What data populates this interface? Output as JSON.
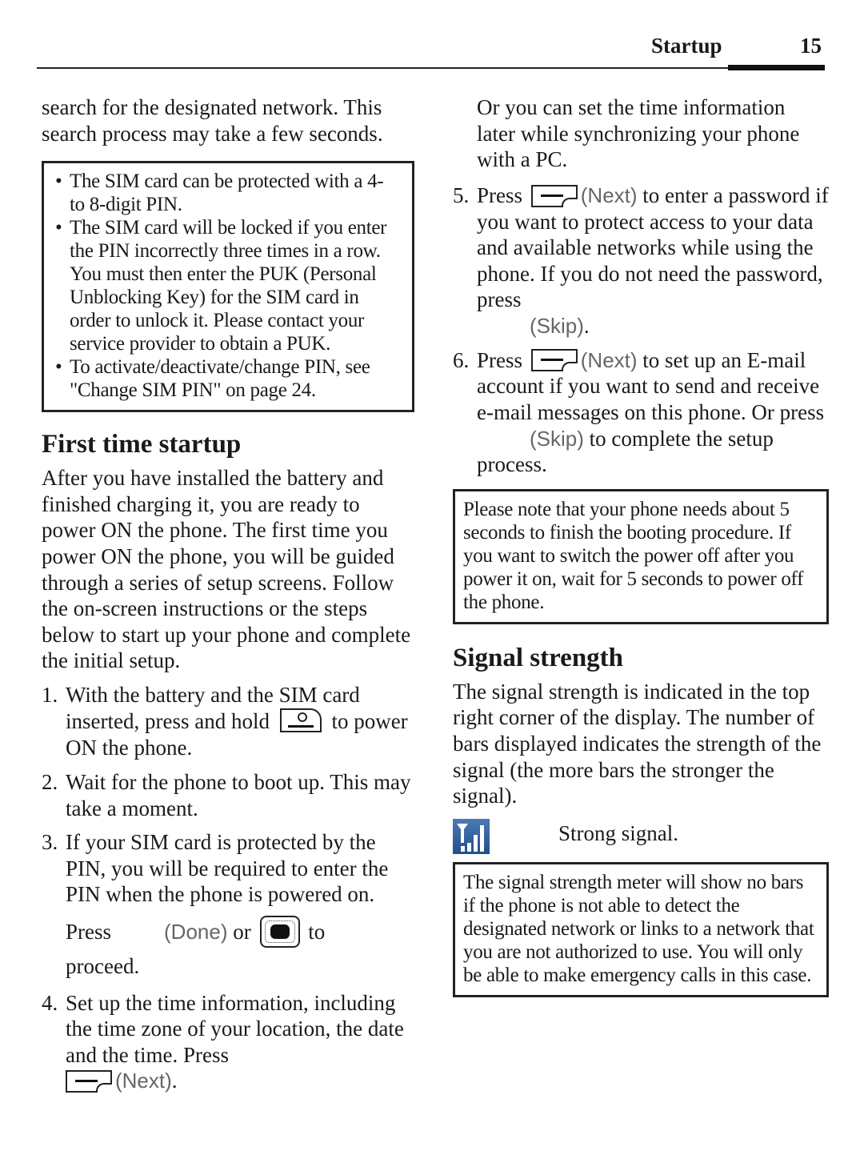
{
  "header": {
    "section": "Startup",
    "page_number": "15"
  },
  "left": {
    "intro_cont": "search for the designated network. This search process may take a few seconds.",
    "pin_box": {
      "bullets": [
        "The SIM card can be protected with a 4- to 8-digit PIN.",
        "The SIM card will be locked if you enter the PIN incorrectly three times in a row. You must then enter the PUK (Personal Unblocking Key) for the SIM card in order to unlock it. Please contact your service provider to obtain a PUK.",
        "To activate/deactivate/change PIN, see \"Change SIM PIN\" on page 24."
      ]
    },
    "heading": "First time startup",
    "intro": "After you have installed the battery and finished charging it, you are ready to power ON the phone. The first time you power ON the phone, you will be guided through a series of setup screens. Follow the on-screen instructions or the steps below to start up your phone and complete the initial setup.",
    "steps": [
      {
        "num": "1.",
        "a": "With the battery and the SIM card inserted, press and hold",
        "b": "to power ON the phone."
      },
      {
        "num": "2.",
        "text": "Wait for the phone to boot up. This may take a moment."
      },
      {
        "num": "3.",
        "text": "If your SIM card is protected by the PIN, you will be required to enter the PIN when the phone is powered on.",
        "press": "Press",
        "softkey": "(Done)",
        "or": "or",
        "to": "to",
        "proceed": "proceed."
      },
      {
        "num": "4.",
        "text": "Set up the time information, including the time zone of your location, the date and the time. Press",
        "softkey": "(Next)",
        "end": "."
      }
    ]
  },
  "right": {
    "step4_cont": "Or you can set the time information later while synchronizing your phone with a PC.",
    "steps": [
      {
        "num": "5.",
        "press": "Press",
        "softkey": "(Next)",
        "text": "to enter a password if you want to protect access to your data and available networks while using the phone. If you do not need the password, press",
        "skip": "(Skip)",
        "end": "."
      },
      {
        "num": "6.",
        "press": "Press",
        "softkey": "(Next)",
        "text": "to set up an E-mail account if you want to send and receive e-mail messages on this phone. Or press",
        "skip": "(Skip)",
        "end": "to complete the setup process."
      }
    ],
    "note_box": "Please note that your phone needs about 5 seconds to finish the booting procedure. If you want to switch the power off after you power it on, wait for 5 seconds to power off the phone.",
    "heading": "Signal strength",
    "signal_intro": "The signal strength is indicated in the top right corner of the display. The number of bars displayed indicates the strength of the signal (the more bars the stronger the signal).",
    "signal_icon": {
      "icon": "signal-strength-icon",
      "bars": 3,
      "max_bars": 3,
      "label": "Strong signal."
    },
    "signal_box": "The signal strength meter will show no bars if the phone is not able to detect the designated network or links to a network that you are not authorized to use. You will only be able to make emergency calls in this case."
  }
}
